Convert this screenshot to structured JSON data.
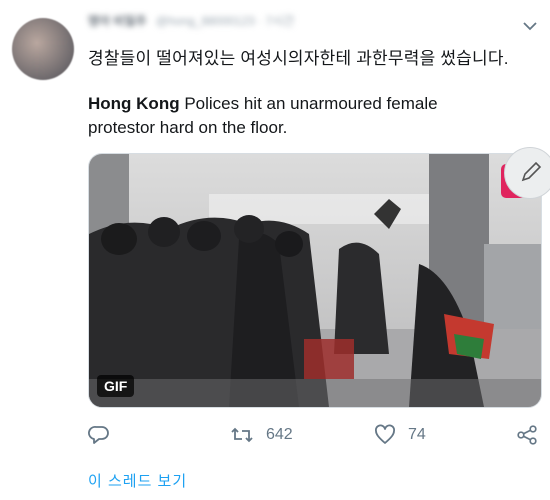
{
  "tweet": {
    "author_name": "명아 비밀주",
    "author_handle": "@hong_88000123 · 7시간",
    "text_korean": "경찰들이 떨어져있는 여성시의자한테 과한무력을 썼습니다.",
    "text_english_bold": "Hong Kong",
    "text_english_rest": " Polices hit an unarmoured female protestor hard on the floor.",
    "media_badge": "GIF",
    "thread_link": "이 스레드 보기"
  },
  "actions": {
    "reply_icon": "reply-icon",
    "retweet_icon": "retweet-icon",
    "retweet_count": "642",
    "like_icon": "heart-icon",
    "like_count": "74",
    "share_icon": "share-icon"
  },
  "colors": {
    "text": "#14171a",
    "muted": "#657786",
    "link": "#1da1f2",
    "media_icon": "#e0245e"
  }
}
